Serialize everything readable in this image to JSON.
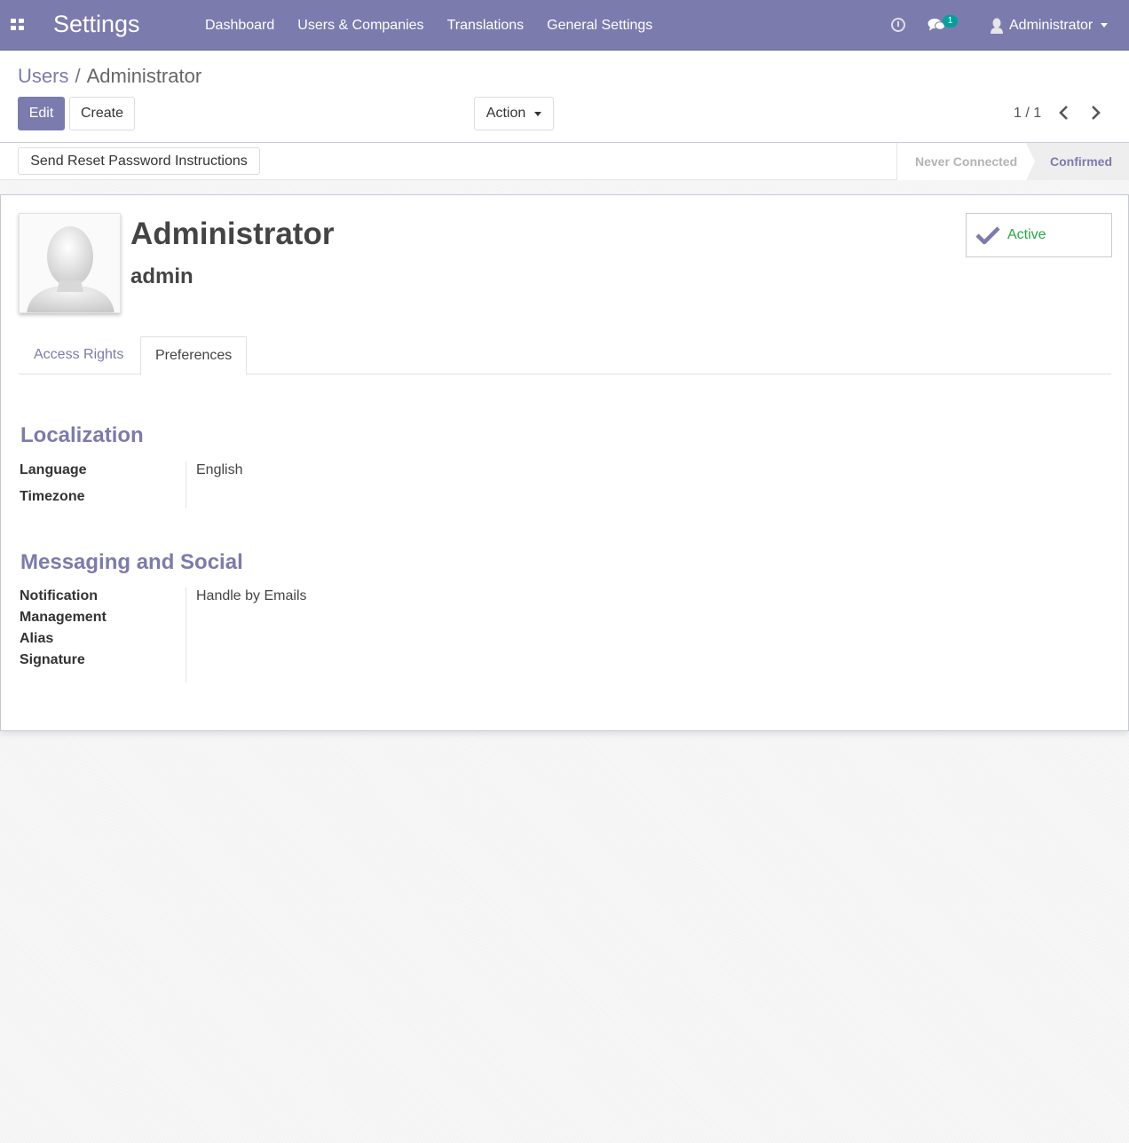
{
  "navbar": {
    "brand": "Settings",
    "menu": [
      "Dashboard",
      "Users & Companies",
      "Translations",
      "General Settings"
    ],
    "chat_badge": "1",
    "user_name": "Administrator",
    "color": "#7c7bad"
  },
  "breadcrumb": {
    "parent": "Users",
    "separator": "/",
    "current": "Administrator"
  },
  "buttons": {
    "edit": "Edit",
    "create": "Create",
    "action": "Action",
    "reset_password": "Send Reset Password Instructions"
  },
  "pager": {
    "value": "1 / 1"
  },
  "status": {
    "steps": [
      "Never Connected",
      "Confirmed"
    ],
    "current": "Confirmed"
  },
  "record": {
    "name": "Administrator",
    "login": "admin",
    "active_label": "Active"
  },
  "tabs": [
    "Access Rights",
    "Preferences"
  ],
  "active_tab": "Preferences",
  "sections": {
    "localization": {
      "title": "Localization",
      "fields": [
        {
          "label": "Language",
          "value": "English"
        },
        {
          "label": "Timezone",
          "value": ""
        }
      ]
    },
    "messaging": {
      "title": "Messaging and Social",
      "fields": [
        {
          "label": "Notification",
          "value": "Handle by Emails"
        },
        {
          "label": "Management",
          "value": ""
        },
        {
          "label": "Alias",
          "value": ""
        },
        {
          "label": "Signature",
          "value": ""
        }
      ]
    }
  }
}
